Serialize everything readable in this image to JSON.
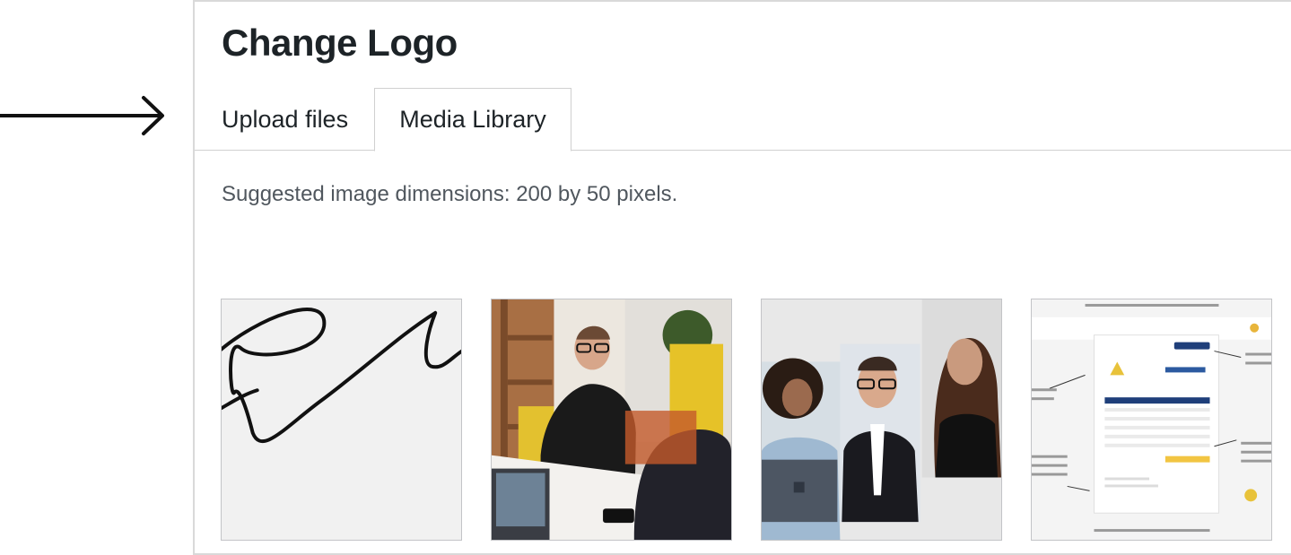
{
  "modal": {
    "title": "Change Logo",
    "hint": "Suggested image dimensions: 200 by 50 pixels."
  },
  "tabs": [
    {
      "label": "Upload files",
      "active": false
    },
    {
      "label": "Media Library",
      "active": true
    }
  ],
  "media": [
    {
      "kind": "signature",
      "alt": "signature"
    },
    {
      "kind": "photo",
      "alt": "man smiling at table"
    },
    {
      "kind": "photo",
      "alt": "three people collage"
    },
    {
      "kind": "screenshot",
      "alt": "invoice template"
    }
  ],
  "colors": {
    "accent": "#1d2327",
    "border": "#d9d9d9",
    "hint": "#50575e"
  }
}
